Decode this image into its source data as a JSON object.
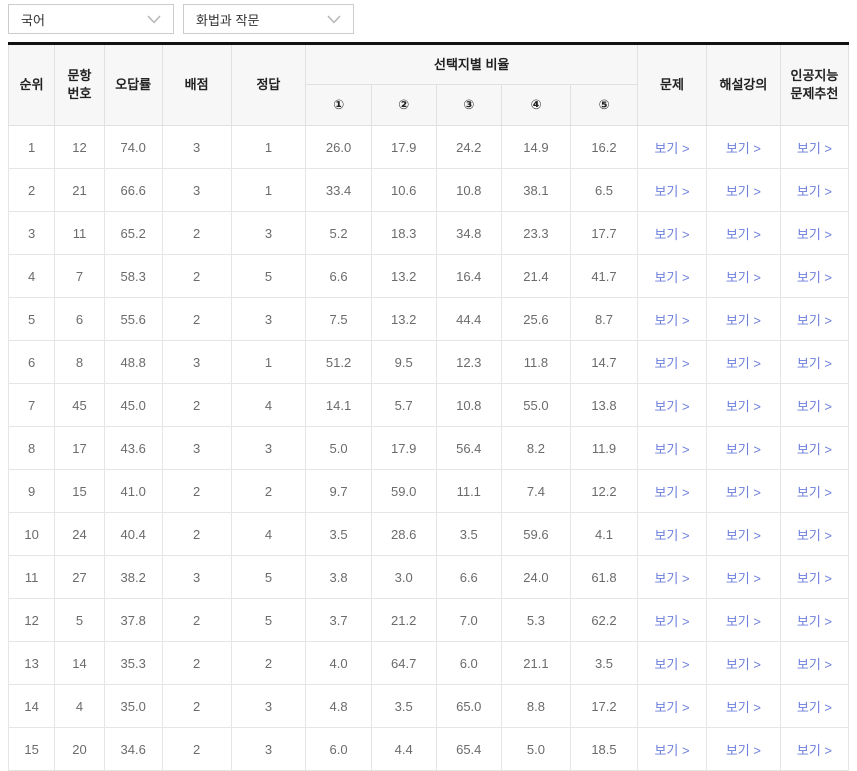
{
  "filters": {
    "subject": {
      "value": "국어"
    },
    "section": {
      "value": "화법과 작문"
    }
  },
  "table": {
    "headers": {
      "rank": "순위",
      "question_no": "문항\n번호",
      "wrong_rate": "오답률",
      "points": "배점",
      "answer": "정답",
      "choice_group": "선택지별 비율",
      "choices": [
        "①",
        "②",
        "③",
        "④",
        "⑤"
      ],
      "problem": "문제",
      "lecture": "해설강의",
      "ai_recommend": "인공지능\n문제추천"
    },
    "view_label": "보기 >",
    "rows": [
      {
        "rank": "1",
        "question_no": "12",
        "wrong_rate": "74.0",
        "points": "3",
        "answer": "1",
        "choice_rates": [
          "26.0",
          "17.9",
          "24.2",
          "14.9",
          "16.2"
        ]
      },
      {
        "rank": "2",
        "question_no": "21",
        "wrong_rate": "66.6",
        "points": "3",
        "answer": "1",
        "choice_rates": [
          "33.4",
          "10.6",
          "10.8",
          "38.1",
          "6.5"
        ]
      },
      {
        "rank": "3",
        "question_no": "11",
        "wrong_rate": "65.2",
        "points": "2",
        "answer": "3",
        "choice_rates": [
          "5.2",
          "18.3",
          "34.8",
          "23.3",
          "17.7"
        ]
      },
      {
        "rank": "4",
        "question_no": "7",
        "wrong_rate": "58.3",
        "points": "2",
        "answer": "5",
        "choice_rates": [
          "6.6",
          "13.2",
          "16.4",
          "21.4",
          "41.7"
        ]
      },
      {
        "rank": "5",
        "question_no": "6",
        "wrong_rate": "55.6",
        "points": "2",
        "answer": "3",
        "choice_rates": [
          "7.5",
          "13.2",
          "44.4",
          "25.6",
          "8.7"
        ]
      },
      {
        "rank": "6",
        "question_no": "8",
        "wrong_rate": "48.8",
        "points": "3",
        "answer": "1",
        "choice_rates": [
          "51.2",
          "9.5",
          "12.3",
          "11.8",
          "14.7"
        ]
      },
      {
        "rank": "7",
        "question_no": "45",
        "wrong_rate": "45.0",
        "points": "2",
        "answer": "4",
        "choice_rates": [
          "14.1",
          "5.7",
          "10.8",
          "55.0",
          "13.8"
        ]
      },
      {
        "rank": "8",
        "question_no": "17",
        "wrong_rate": "43.6",
        "points": "3",
        "answer": "3",
        "choice_rates": [
          "5.0",
          "17.9",
          "56.4",
          "8.2",
          "11.9"
        ]
      },
      {
        "rank": "9",
        "question_no": "15",
        "wrong_rate": "41.0",
        "points": "2",
        "answer": "2",
        "choice_rates": [
          "9.7",
          "59.0",
          "11.1",
          "7.4",
          "12.2"
        ]
      },
      {
        "rank": "10",
        "question_no": "24",
        "wrong_rate": "40.4",
        "points": "2",
        "answer": "4",
        "choice_rates": [
          "3.5",
          "28.6",
          "3.5",
          "59.6",
          "4.1"
        ]
      },
      {
        "rank": "11",
        "question_no": "27",
        "wrong_rate": "38.2",
        "points": "3",
        "answer": "5",
        "choice_rates": [
          "3.8",
          "3.0",
          "6.6",
          "24.0",
          "61.8"
        ]
      },
      {
        "rank": "12",
        "question_no": "5",
        "wrong_rate": "37.8",
        "points": "2",
        "answer": "5",
        "choice_rates": [
          "3.7",
          "21.2",
          "7.0",
          "5.3",
          "62.2"
        ]
      },
      {
        "rank": "13",
        "question_no": "14",
        "wrong_rate": "35.3",
        "points": "2",
        "answer": "2",
        "choice_rates": [
          "4.0",
          "64.7",
          "6.0",
          "21.1",
          "3.5"
        ]
      },
      {
        "rank": "14",
        "question_no": "4",
        "wrong_rate": "35.0",
        "points": "2",
        "answer": "3",
        "choice_rates": [
          "4.8",
          "3.5",
          "65.0",
          "8.8",
          "17.2"
        ]
      },
      {
        "rank": "15",
        "question_no": "20",
        "wrong_rate": "34.6",
        "points": "2",
        "answer": "3",
        "choice_rates": [
          "6.0",
          "4.4",
          "65.4",
          "5.0",
          "18.5"
        ]
      }
    ]
  },
  "colors": {
    "link": "#6d7edb",
    "header_bg": "#f7f7f7",
    "table_top_border": "#111111"
  }
}
